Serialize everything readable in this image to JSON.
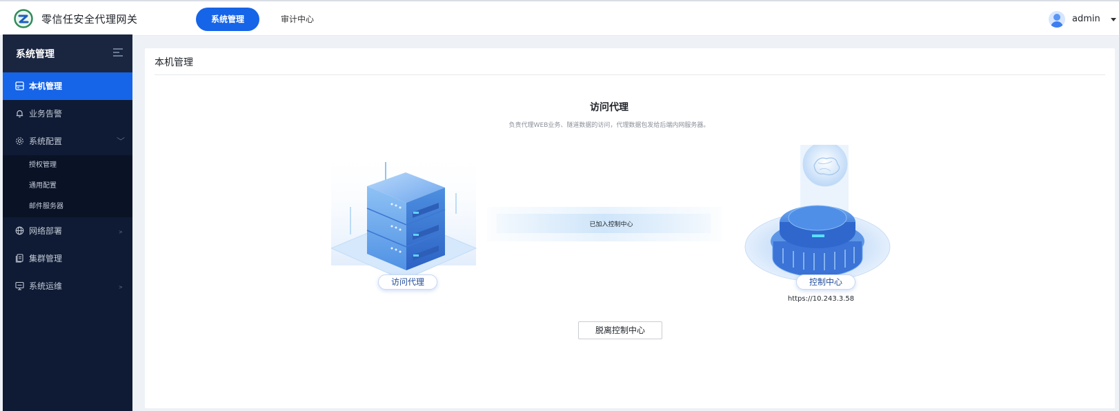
{
  "header": {
    "app_title": "零信任安全代理网关",
    "tabs": [
      {
        "label": "系统管理",
        "active": true
      },
      {
        "label": "审计中心",
        "active": false
      }
    ],
    "user": {
      "name": "admin"
    }
  },
  "sidebar": {
    "title": "系统管理",
    "items": [
      {
        "label": "本机管理",
        "icon": "server-icon",
        "active": true
      },
      {
        "label": "业务告警",
        "icon": "bell-icon"
      },
      {
        "label": "系统配置",
        "icon": "gear-icon",
        "expanded": true,
        "children": [
          "授权管理",
          "通用配置",
          "邮件服务器"
        ]
      },
      {
        "label": "网络部署",
        "icon": "globe-icon"
      },
      {
        "label": "集群管理",
        "icon": "cluster-icon"
      },
      {
        "label": "系统运维",
        "icon": "monitor-icon"
      }
    ]
  },
  "main": {
    "title": "本机管理",
    "section_title": "访问代理",
    "section_desc": "负责代理WEB业务、隧道数据的访问，代理数据包发给后端内网服务器。",
    "proxy_node_label": "访问代理",
    "link_status": "已加入控制中心",
    "center_node_label": "控制中心",
    "center_url": "https://10.243.3.58",
    "detach_button": "脱离控制中心"
  },
  "colors": {
    "accent": "#1664e8",
    "sidebar_bg": "#0f1b34"
  }
}
